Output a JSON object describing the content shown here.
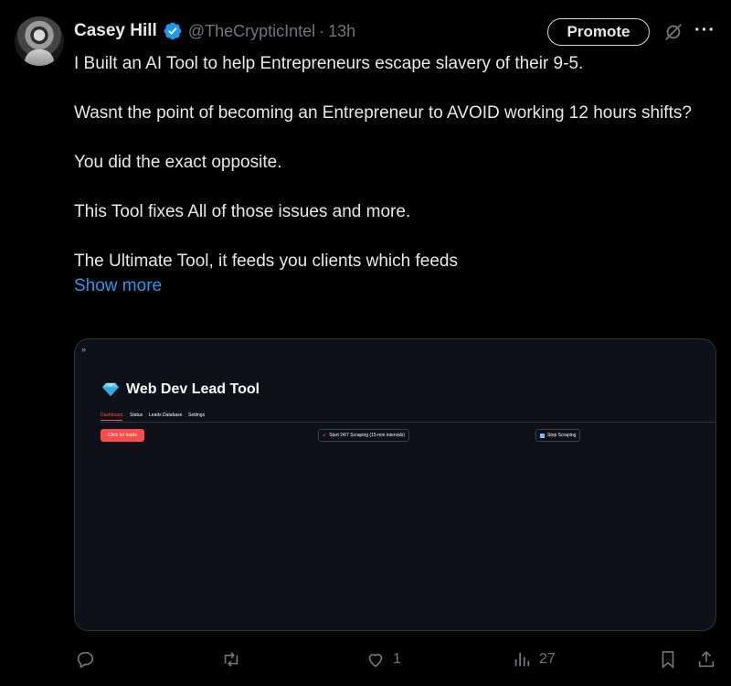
{
  "tweet": {
    "display_name": "Casey Hill",
    "handle": "@TheCrypticIntel",
    "separator": "·",
    "time": "13h",
    "promote_label": "Promote",
    "more_label": "···",
    "paragraphs": [
      "I Built an AI Tool to help Entrepreneurs escape slavery of their 9-5.",
      "Wasnt the point of becoming an Entrepreneur to AVOID working 12 hours shifts?",
      "You did the exact opposite.",
      "This Tool fixes All of those issues and more.",
      "The Ultimate Tool, it feeds you clients which feeds"
    ],
    "show_more": "Show more",
    "accent_color": "#1d9bf0"
  },
  "media": {
    "collapse_icon": "»",
    "app_title": "Web Dev Lead Tool",
    "tabs": [
      "Dashboard",
      "Status",
      "Leads Database",
      "Settings"
    ],
    "active_tab": "Dashboard",
    "buttons": {
      "click_leads": "Click for leads",
      "start_scraping": "Start 24/7 Scraping (15-min intervals)",
      "stop_scraping": "Stop Scraping"
    },
    "accent_color": "#ff4b4b"
  },
  "actions": {
    "reply_count": "",
    "retweet_count": "",
    "like_count": "1",
    "views_count": "27"
  }
}
